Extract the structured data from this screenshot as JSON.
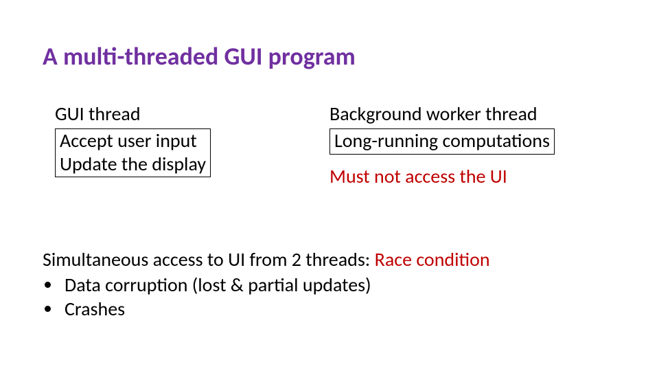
{
  "title": "A multi-threaded GUI program",
  "left": {
    "heading": "GUI thread",
    "line1": "Accept user input",
    "line2": "Update the display"
  },
  "right": {
    "heading": "Background worker thread",
    "line1": "Long-running computations",
    "warn": "Must not access the UI"
  },
  "bottom": {
    "intro": "Simultaneous access to UI from 2 threads:  ",
    "race": "Race condition",
    "b1": "Data corruption (lost & partial updates)",
    "b2": "Crashes"
  }
}
